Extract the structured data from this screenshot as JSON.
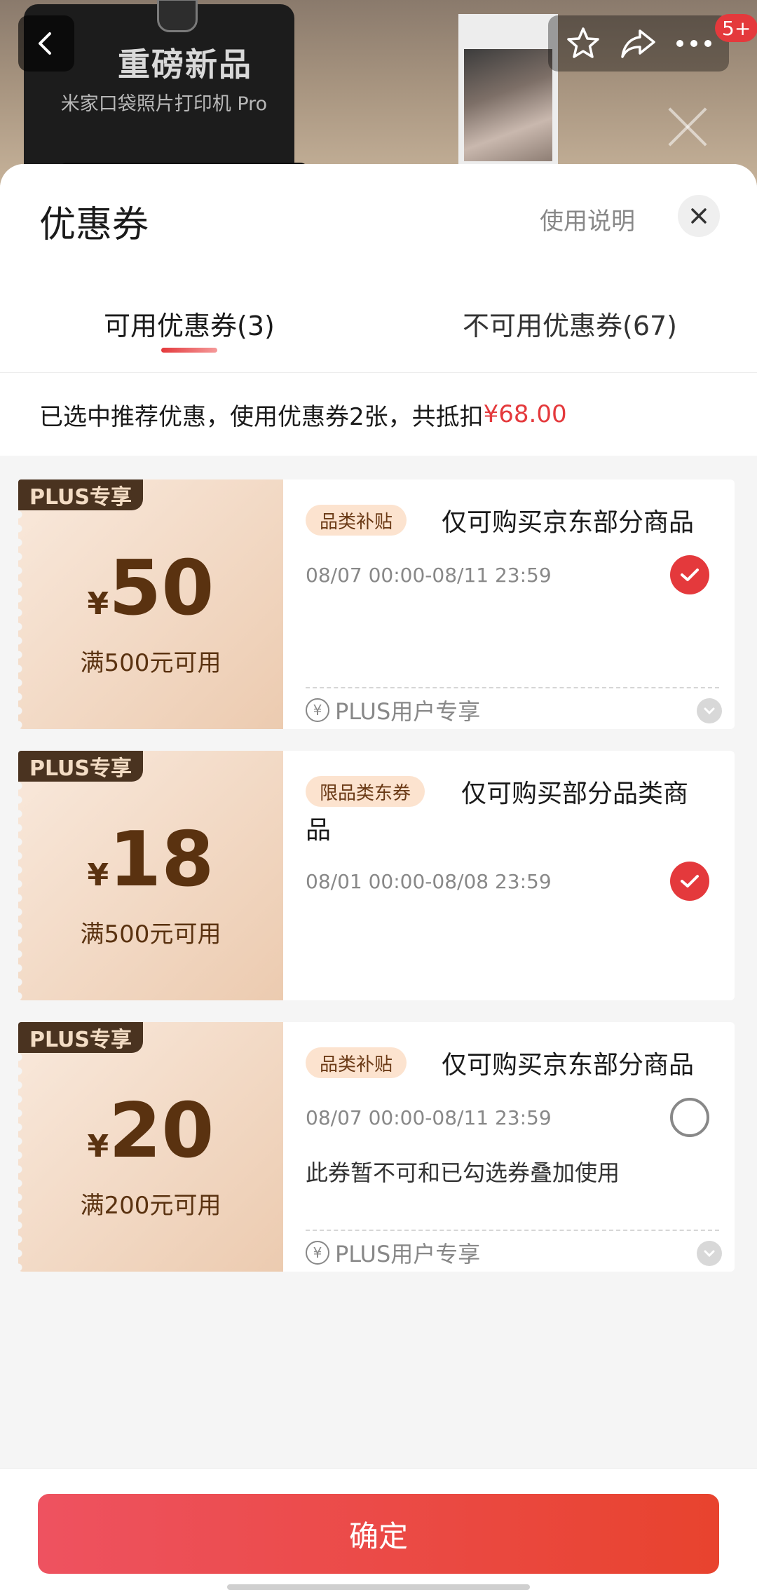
{
  "background": {
    "promo_title": "重磅新品",
    "promo_subtitle": "米家口袋照片打印机 Pro"
  },
  "topbar": {
    "back_icon": "chevron-left-icon",
    "actions": [
      "star-icon",
      "share-icon",
      "more-icon"
    ],
    "message_badge": "5+"
  },
  "sheet": {
    "title": "优惠券",
    "usage_link": "使用说明",
    "tabs": [
      {
        "label": "可用优惠券(3)",
        "active": true
      },
      {
        "label": "不可用优惠券(67)",
        "active": false
      }
    ],
    "summary": {
      "text": "已选中推荐优惠，使用优惠券2张，共抵扣",
      "amount": "¥68.00"
    }
  },
  "coupons": [
    {
      "badge": "PLUS专享",
      "currency": "¥",
      "amount": "50",
      "condition": "满500元可用",
      "tag": "品类补贴",
      "title": "仅可购买京东部分商品",
      "validity": "08/07 00:00-08/11 23:59",
      "selected": true,
      "footer": "PLUS用户专享"
    },
    {
      "badge": "PLUS专享",
      "currency": "¥",
      "amount": "18",
      "condition": "满500元可用",
      "tag": "限品类东券",
      "title_line1": "仅可购买部分品类商",
      "title_line2": "品",
      "validity": "08/01 00:00-08/08 23:59",
      "selected": true
    },
    {
      "badge": "PLUS专享",
      "currency": "¥",
      "amount": "20",
      "condition": "满200元可用",
      "tag": "品类补贴",
      "title": "仅可购买京东部分商品",
      "validity": "08/07 00:00-08/11 23:59",
      "selected": false,
      "note": "此券暂不可和已勾选券叠加使用",
      "footer": "PLUS用户专享"
    }
  ],
  "footer": {
    "confirm_label": "确定"
  },
  "colors": {
    "accent": "#e4393c",
    "coupon_brown": "#5a3210"
  }
}
